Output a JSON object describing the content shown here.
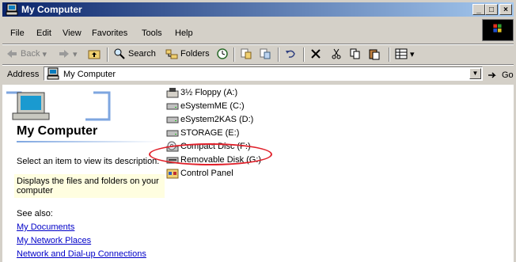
{
  "window": {
    "title": "My Computer"
  },
  "title_buttons": {
    "minimize": "_",
    "maximize": "□",
    "close": "×"
  },
  "menu": [
    "File",
    "Edit",
    "View",
    "Favorites",
    "Tools",
    "Help"
  ],
  "toolbar": {
    "back": "Back",
    "search": "Search",
    "folders": "Folders"
  },
  "address": {
    "label": "Address",
    "value": "My Computer",
    "go": "Go"
  },
  "left_panel": {
    "heading": "My Computer",
    "prompt": "Select an item to view its description.",
    "description": "Displays the files and folders on your computer",
    "see_also_label": "See also:",
    "links": [
      "My Documents",
      "My Network Places",
      "Network and Dial-up Connections"
    ]
  },
  "items": [
    {
      "label": "3½ Floppy (A:)",
      "icon": "floppy-icon"
    },
    {
      "label": "eSystemME (C:)",
      "icon": "hard-drive-icon"
    },
    {
      "label": "eSystem2KAS (D:)",
      "icon": "hard-drive-icon"
    },
    {
      "label": "STORAGE (E:)",
      "icon": "hard-drive-icon"
    },
    {
      "label": "Compact Disc (F:)",
      "icon": "cd-drive-icon"
    },
    {
      "label": "Removable Disk (G:)",
      "icon": "removable-disk-icon"
    },
    {
      "label": "Control Panel",
      "icon": "control-panel-icon"
    }
  ],
  "colors": {
    "title_start": "#0a246a",
    "title_end": "#a6caf0",
    "highlight_circle": "#e0202a",
    "link": "#0000c8"
  }
}
